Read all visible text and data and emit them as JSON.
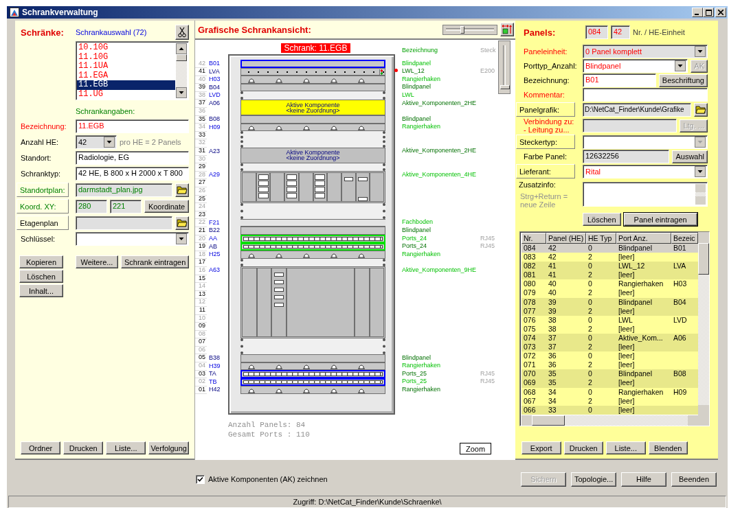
{
  "window": {
    "title": "Schrankverwaltung"
  },
  "cabinets": {
    "heading": "Schränke:",
    "selection_label": "Schrankauswahl (72)",
    "list": [
      {
        "name": "10.10G",
        "selected": false
      },
      {
        "name": "11.10G",
        "selected": false
      },
      {
        "name": "11.1UA",
        "selected": false
      },
      {
        "name": "11.EGA",
        "selected": false
      },
      {
        "name": "11.EGB",
        "selected": true
      },
      {
        "name": "11.UG",
        "selected": false
      }
    ],
    "details_heading": "Schrankangaben:",
    "fields": [
      {
        "kind": "text",
        "label": "Bezeichnung:",
        "required": true,
        "label_button": false,
        "linked": false,
        "value": "11.EGB",
        "emphasis": true,
        "readonly": false
      },
      {
        "kind": "combo",
        "label": "Anzahl HE:",
        "required": false,
        "label_button": false,
        "linked": false,
        "value": "42",
        "readonly": true,
        "short": true,
        "note": "pro HE = 2 Panels"
      },
      {
        "kind": "text",
        "label": "Standort:",
        "required": false,
        "label_button": false,
        "linked": false,
        "value": "Radiologie, EG",
        "emphasis": false,
        "readonly": false
      },
      {
        "kind": "text",
        "label": "Schranktyp:",
        "required": false,
        "label_button": false,
        "linked": false,
        "value": "42 HE, B 800 x H 2000 x T 800",
        "emphasis": false,
        "readonly": false
      },
      {
        "kind": "file",
        "label": "Standortplan:",
        "required": false,
        "label_button": true,
        "linked": true,
        "value": "darmstadt_plan.jpg"
      },
      {
        "kind": "coords",
        "label": "Koord. XY:",
        "required": false,
        "label_button": true,
        "linked": true,
        "values": [
          "280",
          "221"
        ],
        "button": "Koordinate"
      },
      {
        "kind": "file",
        "label": "Etagenplan",
        "required": false,
        "label_button": true,
        "linked": false
      },
      {
        "kind": "combo",
        "label": "Schlüssel:",
        "required": false,
        "label_button": false,
        "linked": false,
        "readonly": false,
        "short": false
      }
    ],
    "action_columns": [
      [
        "Kopieren",
        "Löschen",
        "Inhalt..."
      ],
      [
        "Weitere...",
        "Schrank eintragen"
      ]
    ],
    "footer_buttons": [
      "Ordner",
      "Drucken",
      "Liste...",
      "Verfolgung"
    ]
  },
  "rack_view": {
    "heading": "Grafische Schrankansicht:",
    "zoom_slider": {
      "level": 0.35
    },
    "scroll_slider": {
      "level": 0
    },
    "title": "Schrank: 11.EGB",
    "column_header": "Bezeichnung",
    "column_header_2": "Steck",
    "units": [
      {
        "he": "42",
        "label": "B01",
        "type": "Blindpanel",
        "kind": "blank",
        "selected": true
      },
      {
        "he": "41",
        "label": "LVA",
        "type": "LWL_12",
        "port": "E200",
        "kind": "fiber",
        "selected": false
      },
      {
        "he": "40",
        "label": "H03",
        "type": "Rangierhaken",
        "kind": "hooks",
        "selected": false
      },
      {
        "he": "39",
        "label": "B04",
        "type": "Blindpanel",
        "kind": "blank",
        "selected": false
      },
      {
        "he": "38",
        "label": "LVD",
        "type": "LWL",
        "kind": "empty",
        "selected": false
      },
      {
        "he": "37",
        "label": "A06",
        "type": "Aktive_Komponenten_2HE",
        "kind": "active",
        "color": "#ffff00",
        "lines": [
          "Aktive Komponente",
          "<keine Zuordnung>"
        ],
        "selected": false
      },
      {
        "he": "36"
      },
      {
        "he": "35",
        "label": "B08",
        "type": "Blindpanel",
        "kind": "blank",
        "selected": false
      },
      {
        "he": "34",
        "label": "H09",
        "type": "Rangierhaken",
        "kind": "hooks",
        "selected": false
      },
      {
        "he": "33",
        "kind": "empty",
        "selected": false
      },
      {
        "he": "32"
      },
      {
        "he": "31",
        "label": "A23",
        "type": "Aktive_Komponenten_2HE",
        "kind": "active",
        "color": "#c0c0c0",
        "lines": [
          "Aktive Komponente",
          "<keine Zuordnung>"
        ],
        "selected": false
      },
      {
        "he": "30"
      },
      {
        "he": "29",
        "kind": "empty",
        "selected": false
      },
      {
        "he": "28",
        "label": "A29",
        "type": "Aktive_Komponenten_4HE",
        "kind": "chassis",
        "selected": false
      },
      {
        "he": "27"
      },
      {
        "he": "26"
      },
      {
        "he": "25"
      },
      {
        "he": "24",
        "kind": "empty",
        "selected": false
      },
      {
        "he": "23"
      },
      {
        "he": "22",
        "label": "F21",
        "type": "Fachboden",
        "kind": "shelf",
        "selected": false
      },
      {
        "he": "21",
        "label": "B22",
        "type": "Blindpanel",
        "kind": "blank",
        "selected": false
      },
      {
        "he": "20",
        "label": "AA",
        "type": "Ports_24",
        "port": "RJ45",
        "kind": "ports",
        "color": "#00e000",
        "selected": false
      },
      {
        "he": "19",
        "label": "AB",
        "type": "Ports_24",
        "port": "RJ45",
        "kind": "ports",
        "color": "#00e000",
        "selected": false
      },
      {
        "he": "18",
        "label": "H25",
        "type": "Rangierhaken",
        "kind": "hooks",
        "selected": false
      },
      {
        "he": "17",
        "kind": "empty",
        "selected": false
      },
      {
        "he": "16",
        "label": "A63",
        "type": "Aktive_Komponenten_9HE",
        "kind": "chassis",
        "selected": false
      },
      {
        "he": "15"
      },
      {
        "he": "14"
      },
      {
        "he": "13"
      },
      {
        "he": "12"
      },
      {
        "he": "11"
      },
      {
        "he": "10"
      },
      {
        "he": "09"
      },
      {
        "he": "08"
      },
      {
        "he": "07",
        "kind": "empty",
        "selected": false
      },
      {
        "he": "06"
      },
      {
        "he": "05",
        "label": "B38",
        "type": "Blindpanel",
        "kind": "blank",
        "selected": false
      },
      {
        "he": "04",
        "label": "H39",
        "type": "Rangierhaken",
        "kind": "hooks",
        "selected": false
      },
      {
        "he": "03",
        "label": "TA",
        "type": "Ports_25",
        "port": "RJ45",
        "kind": "ports",
        "color": "#0000ff",
        "selected": false
      },
      {
        "he": "02",
        "label": "TB",
        "type": "Ports_25",
        "port": "RJ45",
        "kind": "ports",
        "color": "#0000ff",
        "selected": false
      },
      {
        "he": "01",
        "label": "H42",
        "type": "Rangierhaken",
        "kind": "hooks",
        "selected": false
      }
    ],
    "summary": [
      "Anzahl Panels: 84",
      "Gesamt Ports : 110"
    ],
    "zoom_button": "Zoom"
  },
  "panels": {
    "heading": "Panels:",
    "number": "084",
    "he": "42",
    "caption": "Nr. / HE-Einheit",
    "fields": [
      {
        "kind": "combo",
        "label": "Paneleinheit:",
        "required": true,
        "label_button": false,
        "linked": false,
        "value": "0  Panel komplett",
        "emphasis": true,
        "readonly": true
      },
      {
        "kind": "combo",
        "label": "Porttyp_Anzahl:",
        "required": false,
        "label_button": false,
        "linked": false,
        "value": "Blindpanel",
        "emphasis": true,
        "readonly": false,
        "button": "AK",
        "button_disabled": true
      },
      {
        "kind": "text",
        "label": "Bezeichnung:",
        "required": false,
        "label_button": false,
        "linked": false,
        "value": "B01",
        "emphasis": true,
        "readonly": false,
        "button": "Beschriftung",
        "button_disabled": false
      },
      {
        "kind": "text",
        "label": "Kommentar:",
        "required": true,
        "label_button": false,
        "linked": false,
        "readonly": false
      },
      {
        "kind": "file",
        "label": "Panelgrafik:",
        "required": false,
        "label_button": true,
        "linked": false,
        "value": "D:\\NetCat_Finder\\Kunde\\Grafike"
      },
      {
        "kind": "text",
        "label": "Verbindung zu:",
        "label_2": "- Leitung zu...",
        "required": true,
        "label_button": false,
        "linked": false,
        "readonly": true,
        "button": "Ltg. ...",
        "button_disabled": true
      },
      {
        "kind": "combo",
        "label": "Steckertyp:",
        "required": false,
        "label_button": true,
        "linked": false,
        "readonly": false,
        "arrow_disabled": true
      },
      {
        "kind": "text",
        "label": "Farbe Panel:",
        "required": false,
        "label_button": false,
        "linked": false,
        "value": "12632256",
        "emphasis": false,
        "readonly": true,
        "button": "Auswahl",
        "button_disabled": false
      },
      {
        "kind": "combo",
        "label": "Lieferant:",
        "required": false,
        "label_button": true,
        "linked": false,
        "value": "Rital",
        "emphasis": true,
        "readonly": false
      },
      {
        "kind": "memo",
        "label": "Zusatzinfo:",
        "hint": "Strg+Return = neue Zeile"
      }
    ],
    "buttons": [
      {
        "label": "Löschen",
        "default": false
      },
      {
        "label": "Panel eintragen",
        "default": true
      }
    ],
    "table": {
      "columns": [
        "Nr.",
        "Panel (HE)",
        "HE Typ",
        "Port Anz.",
        "Bezeic"
      ],
      "rows": [
        {
          "cells": [
            "084",
            "42",
            "0",
            "Blindpanel",
            "B01"
          ],
          "selected": true
        },
        {
          "cells": [
            "083",
            "42",
            "2",
            "[leer]"
          ],
          "selected": false
        },
        {
          "cells": [
            "082",
            "41",
            "0",
            "LWL_12",
            "LVA"
          ],
          "selected": false
        },
        {
          "cells": [
            "081",
            "41",
            "2",
            "[leer]"
          ],
          "selected": false
        },
        {
          "cells": [
            "080",
            "40",
            "0",
            "Rangierhaken",
            "H03"
          ],
          "selected": false
        },
        {
          "cells": [
            "079",
            "40",
            "2",
            "[leer]"
          ],
          "selected": false
        },
        {
          "cells": [
            "078",
            "39",
            "0",
            "Blindpanel",
            "B04"
          ],
          "selected": false
        },
        {
          "cells": [
            "077",
            "39",
            "2",
            "[leer]"
          ],
          "selected": false
        },
        {
          "cells": [
            "076",
            "38",
            "0",
            "LWL",
            "LVD"
          ],
          "selected": false
        },
        {
          "cells": [
            "075",
            "38",
            "2",
            "[leer]"
          ],
          "selected": false
        },
        {
          "cells": [
            "074",
            "37",
            "0",
            "Aktive_Kom...",
            "A06"
          ],
          "selected": false
        },
        {
          "cells": [
            "073",
            "37",
            "2",
            "[leer]"
          ],
          "selected": false
        },
        {
          "cells": [
            "072",
            "36",
            "0",
            "[leer]"
          ],
          "selected": false
        },
        {
          "cells": [
            "071",
            "36",
            "2",
            "[leer]"
          ],
          "selected": false
        },
        {
          "cells": [
            "070",
            "35",
            "0",
            "Blindpanel",
            "B08"
          ],
          "selected": false
        },
        {
          "cells": [
            "069",
            "35",
            "2",
            "[leer]"
          ],
          "selected": false
        },
        {
          "cells": [
            "068",
            "34",
            "0",
            "Rangierhaken",
            "H09"
          ],
          "selected": false
        },
        {
          "cells": [
            "067",
            "34",
            "2",
            "[leer]"
          ],
          "selected": false
        },
        {
          "cells": [
            "066",
            "33",
            "0",
            "[leer]"
          ],
          "selected": false
        }
      ]
    },
    "footer_buttons": [
      "Export",
      "Drucken",
      "Liste...",
      "Blenden"
    ]
  },
  "option": {
    "label": "Aktive Komponenten (AK) zeichnen",
    "checked": true
  },
  "buttons": [
    {
      "label": "Sichern",
      "disabled": true
    },
    {
      "label": "Topologie...",
      "disabled": false
    },
    {
      "label": "Hilfe",
      "disabled": false
    },
    {
      "label": "Beenden",
      "disabled": false
    }
  ],
  "status_bar": "Zugriff: D:\\NetCat_Finder\\Kunde\\Schraenke\\"
}
